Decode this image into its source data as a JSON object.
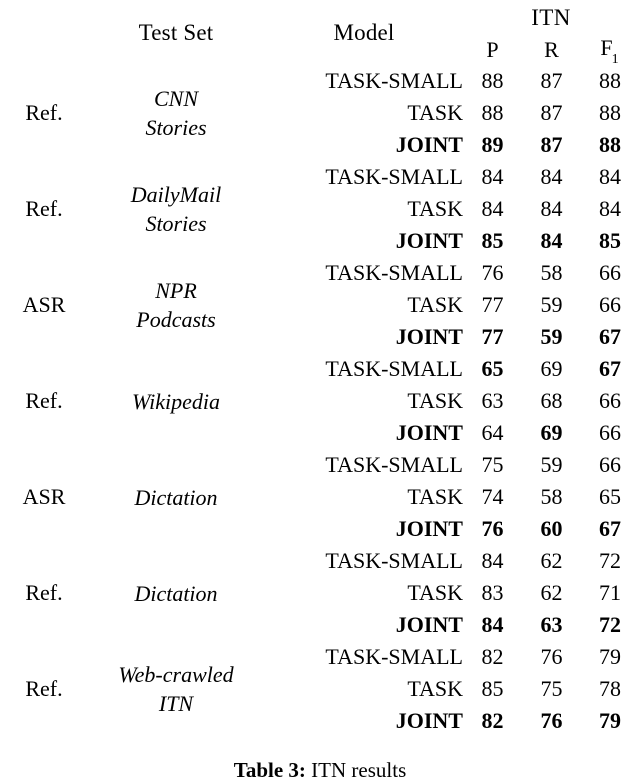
{
  "table": {
    "header": {
      "corner": "",
      "test_set": "Test Set",
      "model": "Model",
      "group": "ITN",
      "metrics": [
        {
          "label": "P",
          "sub": ""
        },
        {
          "label": "R",
          "sub": ""
        },
        {
          "label": "F",
          "sub": "1"
        }
      ]
    },
    "model_names": {
      "task_small": "TASK-SMALL",
      "task": "TASK",
      "joint": "JOINT"
    },
    "blocks": [
      {
        "source": "Ref.",
        "test_set_lines": [
          "CNN",
          "Stories"
        ],
        "rows": [
          {
            "model": "TASK-SMALL",
            "model_bold": false,
            "values": [
              "88",
              "87",
              "88"
            ],
            "bold": [
              false,
              false,
              false
            ]
          },
          {
            "model": "TASK",
            "model_bold": false,
            "values": [
              "88",
              "87",
              "88"
            ],
            "bold": [
              false,
              false,
              false
            ]
          },
          {
            "model": "JOINT",
            "model_bold": true,
            "values": [
              "89",
              "87",
              "88"
            ],
            "bold": [
              true,
              true,
              true
            ]
          }
        ]
      },
      {
        "source": "Ref.",
        "test_set_lines": [
          "DailyMail",
          "Stories"
        ],
        "rows": [
          {
            "model": "TASK-SMALL",
            "model_bold": false,
            "values": [
              "84",
              "84",
              "84"
            ],
            "bold": [
              false,
              false,
              false
            ]
          },
          {
            "model": "TASK",
            "model_bold": false,
            "values": [
              "84",
              "84",
              "84"
            ],
            "bold": [
              false,
              false,
              false
            ]
          },
          {
            "model": "JOINT",
            "model_bold": true,
            "values": [
              "85",
              "84",
              "85"
            ],
            "bold": [
              true,
              true,
              true
            ]
          }
        ]
      },
      {
        "source": "ASR",
        "test_set_lines": [
          "NPR",
          "Podcasts"
        ],
        "rows": [
          {
            "model": "TASK-SMALL",
            "model_bold": false,
            "values": [
              "76",
              "58",
              "66"
            ],
            "bold": [
              false,
              false,
              false
            ]
          },
          {
            "model": "TASK",
            "model_bold": false,
            "values": [
              "77",
              "59",
              "66"
            ],
            "bold": [
              false,
              false,
              false
            ]
          },
          {
            "model": "JOINT",
            "model_bold": true,
            "values": [
              "77",
              "59",
              "67"
            ],
            "bold": [
              true,
              true,
              true
            ]
          }
        ]
      },
      {
        "source": "Ref.",
        "test_set_lines": [
          "Wikipedia"
        ],
        "rows": [
          {
            "model": "TASK-SMALL",
            "model_bold": false,
            "values": [
              "65",
              "69",
              "67"
            ],
            "bold": [
              true,
              false,
              true
            ]
          },
          {
            "model": "TASK",
            "model_bold": false,
            "values": [
              "63",
              "68",
              "66"
            ],
            "bold": [
              false,
              false,
              false
            ]
          },
          {
            "model": "JOINT",
            "model_bold": true,
            "values": [
              "64",
              "69",
              "66"
            ],
            "bold": [
              false,
              true,
              false
            ]
          }
        ]
      },
      {
        "source": "ASR",
        "test_set_lines": [
          "Dictation"
        ],
        "rows": [
          {
            "model": "TASK-SMALL",
            "model_bold": false,
            "values": [
              "75",
              "59",
              "66"
            ],
            "bold": [
              false,
              false,
              false
            ]
          },
          {
            "model": "TASK",
            "model_bold": false,
            "values": [
              "74",
              "58",
              "65"
            ],
            "bold": [
              false,
              false,
              false
            ]
          },
          {
            "model": "JOINT",
            "model_bold": true,
            "values": [
              "76",
              "60",
              "67"
            ],
            "bold": [
              true,
              true,
              true
            ]
          }
        ]
      },
      {
        "source": "Ref.",
        "test_set_lines": [
          "Dictation"
        ],
        "rows": [
          {
            "model": "TASK-SMALL",
            "model_bold": false,
            "values": [
              "84",
              "62",
              "72"
            ],
            "bold": [
              false,
              false,
              false
            ]
          },
          {
            "model": "TASK",
            "model_bold": false,
            "values": [
              "83",
              "62",
              "71"
            ],
            "bold": [
              false,
              false,
              false
            ]
          },
          {
            "model": "JOINT",
            "model_bold": true,
            "values": [
              "84",
              "63",
              "72"
            ],
            "bold": [
              true,
              true,
              true
            ]
          }
        ]
      },
      {
        "source": "Ref.",
        "test_set_lines": [
          "Web-crawled",
          "ITN"
        ],
        "rows": [
          {
            "model": "TASK-SMALL",
            "model_bold": false,
            "values": [
              "82",
              "76",
              "79"
            ],
            "bold": [
              false,
              false,
              false
            ]
          },
          {
            "model": "TASK",
            "model_bold": false,
            "values": [
              "85",
              "75",
              "78"
            ],
            "bold": [
              false,
              false,
              false
            ]
          },
          {
            "model": "JOINT",
            "model_bold": true,
            "values": [
              "82",
              "76",
              "79"
            ],
            "bold": [
              true,
              true,
              true
            ]
          }
        ]
      }
    ]
  },
  "caption": {
    "label": "Table 3:",
    "text": "ITN results"
  }
}
